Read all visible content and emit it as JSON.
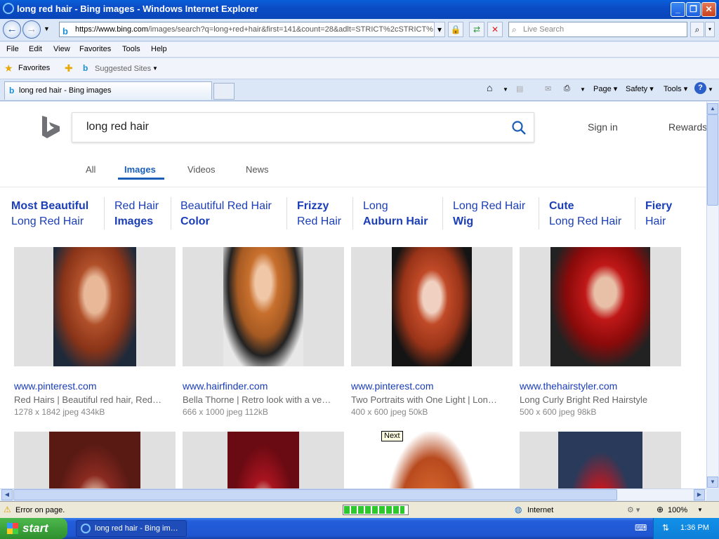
{
  "window": {
    "title": "long red hair - Bing images - Windows Internet Explorer"
  },
  "address": {
    "scheme": "https://",
    "host": "www.bing.com",
    "path": "/images/search?q=long+red+hair&first=141&count=28&adlt=STRICT%2cSTRICT%"
  },
  "live_search": {
    "placeholder": "Live Search"
  },
  "menu": [
    "File",
    "Edit",
    "View",
    "Favorites",
    "Tools",
    "Help"
  ],
  "favorites_bar": {
    "favorites": "Favorites",
    "suggested": "Suggested Sites"
  },
  "tab": {
    "label": "long red hair - Bing images"
  },
  "command_bar": {
    "page": "Page",
    "safety": "Safety",
    "tools": "Tools"
  },
  "bing": {
    "query": "long red hair",
    "sign_in": "Sign in",
    "rewards": "Rewards",
    "scopes": [
      "All",
      "Images",
      "Videos",
      "News"
    ]
  },
  "pills": [
    {
      "l1": "Most Beautiful",
      "l2": "Long Red Hair"
    },
    {
      "l1": "Red Hair",
      "l2": "Images"
    },
    {
      "l1": "Beautiful Red Hair",
      "l2": "Color"
    },
    {
      "l1": "Frizzy",
      "l2": "Red Hair"
    },
    {
      "l1": "Long",
      "l2": "Auburn Hair"
    },
    {
      "l1": "Long Red Hair",
      "l2": "Wig"
    },
    {
      "l1": "Cute",
      "l2": "Long Red Hair"
    },
    {
      "l1": "Fiery",
      "l2": "Hair"
    }
  ],
  "results": [
    {
      "site": "www.pinterest.com",
      "desc": "Red Hairs | Beautiful red hair, Red…",
      "meta": "1278 x 1842 jpeg 434kB"
    },
    {
      "site": "www.hairfinder.com",
      "desc": "Bella Thorne | Retro look with a ve…",
      "meta": "666 x 1000 jpeg 112kB"
    },
    {
      "site": "www.pinterest.com",
      "desc": "Two Portraits with One Light | Lon…",
      "meta": "400 x 600 jpeg 50kB"
    },
    {
      "site": "www.thehairstyler.com",
      "desc": "Long Curly Bright Red Hairstyle",
      "meta": "500 x 600 jpeg 98kB"
    }
  ],
  "tooltip": "Next",
  "status": {
    "error": "Error on page.",
    "zone": "Internet",
    "zoom": "100%",
    "progress": 0.95
  },
  "taskbar": {
    "start": "start",
    "item": "long red hair - Bing im…",
    "clock": "1:36 PM"
  }
}
